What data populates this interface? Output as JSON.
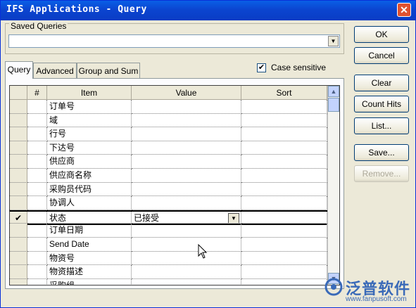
{
  "window": {
    "title": "IFS Applications - Query",
    "close_glyph": "✕"
  },
  "saved_queries": {
    "label": "Saved Queries",
    "value": ""
  },
  "tabs": [
    {
      "label": "Query",
      "active": true
    },
    {
      "label": "Advanced",
      "active": false
    },
    {
      "label": "Group and Sum",
      "active": false
    }
  ],
  "case_sensitive": {
    "label": "Case sensitive",
    "checked": true,
    "glyph": "✔"
  },
  "buttons": {
    "ok": "OK",
    "cancel": "Cancel",
    "clear": "Clear",
    "count_hits": "Count Hits",
    "list": "List...",
    "save": "Save...",
    "remove": "Remove..."
  },
  "grid": {
    "columns": {
      "num": "#",
      "item": "Item",
      "value": "Value",
      "sort": "Sort"
    },
    "rows": [
      {
        "item": "订单号",
        "value": "",
        "sort": ""
      },
      {
        "item": "域",
        "value": "",
        "sort": ""
      },
      {
        "item": "行号",
        "value": "",
        "sort": ""
      },
      {
        "item": "下达号",
        "value": "",
        "sort": ""
      },
      {
        "item": "供应商",
        "value": "",
        "sort": ""
      },
      {
        "item": "供应商名称",
        "value": "",
        "sort": ""
      },
      {
        "item": "采购员代码",
        "value": "",
        "sort": ""
      },
      {
        "item": "协调人",
        "value": "",
        "sort": ""
      },
      {
        "item": "状态",
        "value": "已接受",
        "sort": "",
        "selected": true,
        "marker": "✔"
      },
      {
        "item": "订单日期",
        "value": "",
        "sort": ""
      },
      {
        "item": "Send Date",
        "value": "",
        "sort": ""
      },
      {
        "item": "物资号",
        "value": "",
        "sort": ""
      },
      {
        "item": "物资描述",
        "value": "",
        "sort": ""
      },
      {
        "item": "采购组",
        "value": "",
        "sort": ""
      }
    ]
  },
  "watermark": {
    "brand": "泛普软件",
    "url": "www.fanpusoft.com"
  }
}
